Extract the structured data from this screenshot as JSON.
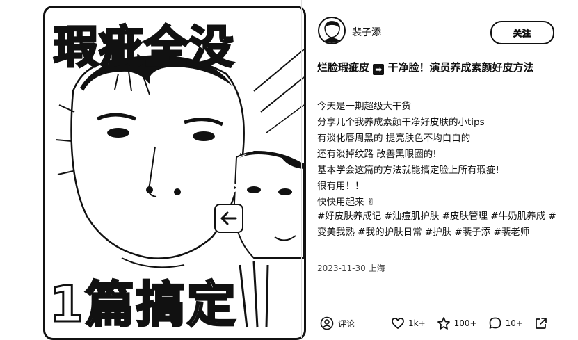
{
  "media": {
    "headline_top": "瑕疵全没",
    "headline_bottom": "1篇搞定"
  },
  "author": {
    "name": "裴子添"
  },
  "follow_label": "关注",
  "post": {
    "title_part1": "烂脸瑕疵皮",
    "title_arrow": "➡",
    "title_part2": "干净脸！演员养成素颜好皮方法",
    "lines": [
      "今天是一期超级大干货",
      "分享几个我养成素颜干净好皮肤的小tips",
      "有淡化唇周黑的 提亮肤色不均白白的",
      "还有淡掉纹路 改善黑眼圈的!",
      "基本学会这篇的方法就能搞定脸上所有瑕疵!",
      "很有用！！",
      "快快用起来 ✌"
    ],
    "tags": "#好皮肤养成记 #油痘肌护肤 #皮肤管理 #牛奶肌养成 #变美我熟 #我的护肤日常 #护肤 #裴子添 #裴老师",
    "date": "2023-11-30",
    "location": "上海"
  },
  "actions": {
    "comment_label": "评论",
    "likes": "1k+",
    "collects": "100+",
    "comments": "10+"
  }
}
